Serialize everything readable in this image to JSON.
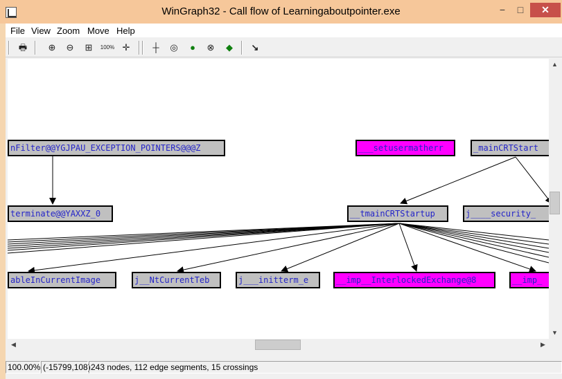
{
  "window": {
    "title": "WinGraph32 - Call flow of Learningaboutpointer.exe",
    "minimize": "−",
    "maximize": "□",
    "close": "✕"
  },
  "menu": {
    "items": [
      {
        "label": "File"
      },
      {
        "label": "View"
      },
      {
        "label": "Zoom"
      },
      {
        "label": "Move"
      },
      {
        "label": "Help"
      }
    ]
  },
  "toolbar": {
    "buttons": [
      {
        "icon": "print-icon",
        "glyph": "🖶"
      },
      {
        "icon": "zoom-in-icon",
        "glyph": "⊕"
      },
      {
        "icon": "zoom-out-icon",
        "glyph": "⊖"
      },
      {
        "icon": "fit-window-icon",
        "glyph": "⊞"
      },
      {
        "icon": "zoom-100-icon",
        "glyph": "100%"
      },
      {
        "icon": "center-icon",
        "glyph": "✛"
      },
      {
        "icon": "layout-icon",
        "glyph": "┼"
      },
      {
        "icon": "fisheye-icon",
        "glyph": "◎"
      },
      {
        "icon": "fisheye-green-icon",
        "glyph": "●"
      },
      {
        "icon": "polar-icon",
        "glyph": "⊗"
      },
      {
        "icon": "fisheye-box-icon",
        "glyph": "◆"
      },
      {
        "icon": "follow-edge-icon",
        "glyph": "↘"
      }
    ]
  },
  "graph": {
    "colors": {
      "gray_node": "#c0c0c0",
      "magenta_node": "#ff00ff",
      "node_text": "#2424c8",
      "edge": "#000000"
    },
    "nodes": {
      "filter": "nFilter@@YGJPAU_EXCEPTION_POINTERS@@@Z",
      "setusermatherr": "___setusermatherr",
      "maincrtstart": "_mainCRTStart",
      "terminate": "terminate@@YAXXZ_0",
      "tmaincrtstartup": "__tmainCRTStartup",
      "security": "j____security_",
      "ableincurrentimage": "ableInCurrentImage",
      "ntcurrentteb": "j__NtCurrentTeb",
      "initterm": "j___initterm_e",
      "interlockedexchange": "__imp__InterlockedExchange@8",
      "imp_partial": "__imp_"
    }
  },
  "status": {
    "zoom": "100.00%",
    "coords": "(-15799,108)",
    "summary": "243 nodes, 112 edge segments, 15 crossings"
  }
}
